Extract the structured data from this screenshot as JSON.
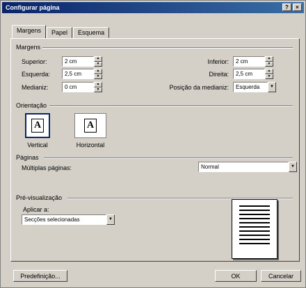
{
  "window": {
    "title": "Configurar página",
    "help_glyph": "?",
    "close_glyph": "×"
  },
  "tabs": [
    {
      "label": "Margens"
    },
    {
      "label": "Papel"
    },
    {
      "label": "Esquema"
    }
  ],
  "margins": {
    "group_label": "Margens",
    "top": {
      "label": "Superior:",
      "value": "2 cm"
    },
    "left": {
      "label": "Esquerda:",
      "value": "2,5 cm"
    },
    "gutter": {
      "label": "Medianiz:",
      "value": "0 cm"
    },
    "bottom": {
      "label": "Inferior:",
      "value": "2 cm"
    },
    "right": {
      "label": "Direita:",
      "value": "2,5 cm"
    },
    "gutter_position": {
      "label": "Posição da medianiz:",
      "value": "Esquerda"
    }
  },
  "orientation": {
    "group_label": "Orientação",
    "portrait": {
      "label": "Vertical",
      "glyph": "A"
    },
    "landscape": {
      "label": "Horizontal",
      "glyph": "A"
    }
  },
  "pages": {
    "group_label": "Páginas",
    "multiple_label": "Múltiplas páginas:",
    "multiple_value": "Normal"
  },
  "preview": {
    "group_label": "Pré-visualização",
    "apply_label": "Aplicar a:",
    "apply_value": "Secções selecionadas"
  },
  "buttons": {
    "default": "Predefinição...",
    "ok": "OK",
    "cancel": "Cancelar"
  }
}
